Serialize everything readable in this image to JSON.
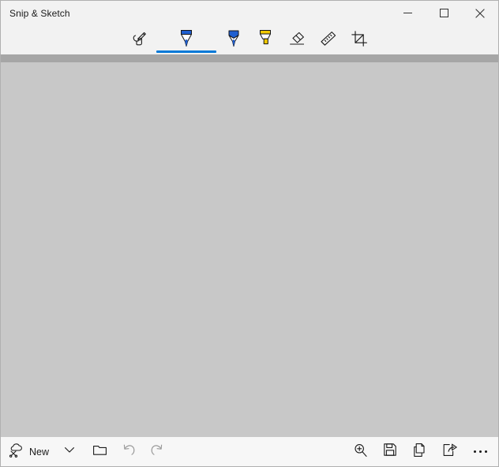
{
  "window": {
    "title": "Snip & Sketch",
    "controls": [
      {
        "name": "minimize",
        "label": "Minimize",
        "glyph": "minimize-icon"
      },
      {
        "name": "maximize",
        "label": "Maximize",
        "glyph": "maximize-icon"
      },
      {
        "name": "close",
        "label": "Close",
        "glyph": "close-icon"
      }
    ]
  },
  "toolbar": {
    "selected_index": 1,
    "accent_color": "#0078d7",
    "tools": [
      {
        "id": "touch-writing",
        "label": "Touch writing",
        "icon": "touch-writing-icon",
        "selected": false
      },
      {
        "id": "ballpoint-pen",
        "label": "Ballpoint pen",
        "icon": "ballpoint-pen-icon",
        "selected": true,
        "color": "#1f5fd0"
      },
      {
        "id": "pencil",
        "label": "Pencil",
        "icon": "pencil-icon",
        "selected": false,
        "color": "#1f5fd0"
      },
      {
        "id": "highlighter",
        "label": "Highlighter",
        "icon": "highlighter-icon",
        "selected": false,
        "color": "#f2c900"
      },
      {
        "id": "eraser",
        "label": "Eraser",
        "icon": "eraser-icon",
        "selected": false
      },
      {
        "id": "ruler",
        "label": "Ruler",
        "icon": "ruler-icon",
        "selected": false
      },
      {
        "id": "image-crop",
        "label": "Image crop",
        "icon": "crop-icon",
        "selected": false
      }
    ]
  },
  "canvas": {
    "background_color": "#c8c8c8",
    "band_color": "#a6a6a6",
    "content": ""
  },
  "bottombar": {
    "left": [
      {
        "id": "new",
        "label": "New",
        "icon": "new-snip-icon",
        "enabled": true
      },
      {
        "id": "new-menu",
        "label": "",
        "icon": "chevron-down-icon",
        "enabled": true
      },
      {
        "id": "open",
        "label": "",
        "icon": "folder-open-icon",
        "enabled": true
      },
      {
        "id": "undo",
        "label": "",
        "icon": "undo-icon",
        "enabled": false
      },
      {
        "id": "redo",
        "label": "",
        "icon": "redo-icon",
        "enabled": false
      }
    ],
    "right": [
      {
        "id": "zoom",
        "label": "",
        "icon": "zoom-in-icon",
        "enabled": true
      },
      {
        "id": "save",
        "label": "",
        "icon": "save-icon",
        "enabled": true
      },
      {
        "id": "copy",
        "label": "",
        "icon": "copy-icon",
        "enabled": true
      },
      {
        "id": "share",
        "label": "",
        "icon": "share-icon",
        "enabled": true
      },
      {
        "id": "more",
        "label": "",
        "icon": "more-options-icon",
        "enabled": true
      }
    ]
  }
}
